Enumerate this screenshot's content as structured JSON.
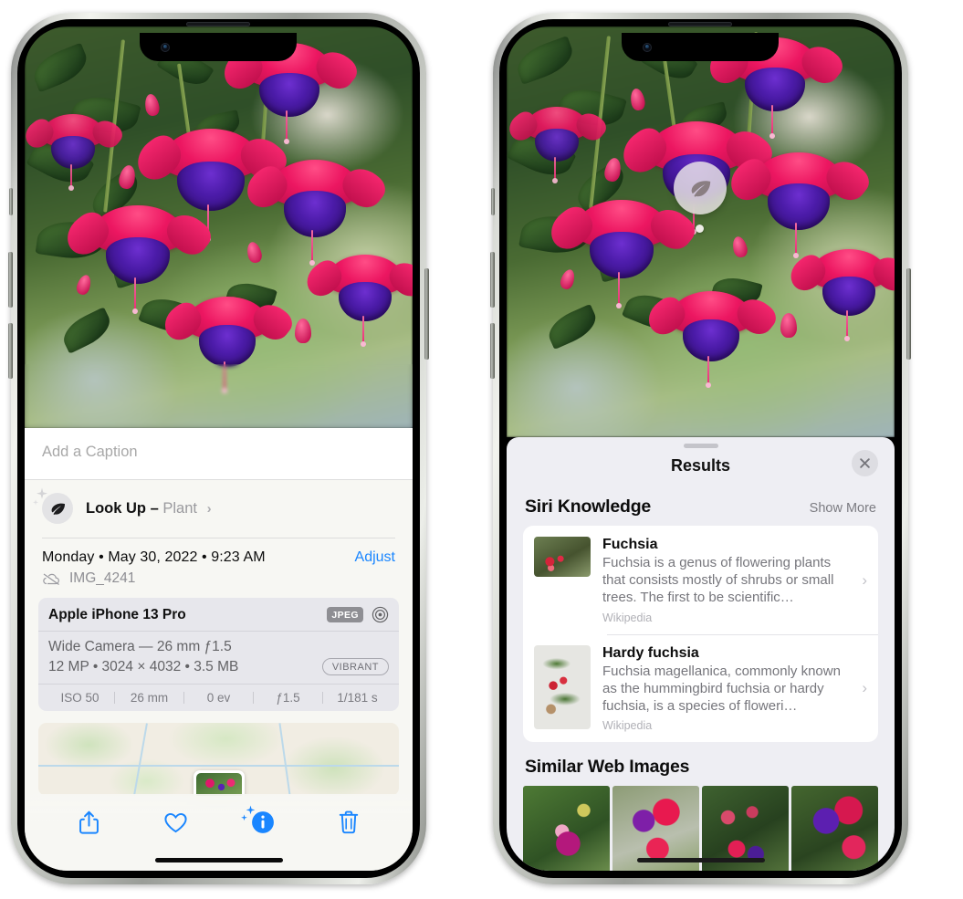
{
  "left_phone": {
    "photo": {
      "alt": "fuchsia-flowers-photo"
    },
    "caption_field": {
      "placeholder": "Add a Caption",
      "value": ""
    },
    "look_up": {
      "icon": "leaf-icon",
      "label": "Look Up –",
      "subject": "Plant",
      "chevron": "›"
    },
    "date_row": {
      "date_text": "Monday • May 30, 2022 • 9:23 AM",
      "adjust_label": "Adjust"
    },
    "file_row": {
      "icon": "cloud-slash-icon",
      "filename": "IMG_4241"
    },
    "camera_card": {
      "model": "Apple iPhone 13 Pro",
      "format_badge": "JPEG",
      "lens_icon": "aperture-icon",
      "lens_line": "Wide Camera — 26 mm ƒ1.5",
      "spec_line": "12 MP • 3024 × 4032 • 3.5 MB",
      "style_badge": "VIBRANT",
      "exif": [
        {
          "label": "ISO 50"
        },
        {
          "label": "26 mm"
        },
        {
          "label": "0 ev"
        },
        {
          "label": "ƒ1.5"
        },
        {
          "label": "1/181 s"
        }
      ]
    },
    "map": {
      "name": "photo-location-map",
      "pin": "photo-thumbnail-pin"
    },
    "toolbar": [
      {
        "name": "share-button",
        "icon": "share-icon",
        "active": false
      },
      {
        "name": "favorite-button",
        "icon": "heart-icon",
        "active": false
      },
      {
        "name": "info-button",
        "icon": "info-sparkle-icon",
        "active": true
      },
      {
        "name": "delete-button",
        "icon": "trash-icon",
        "active": false
      }
    ],
    "accent_color": "#1a86ff"
  },
  "right_phone": {
    "visual_look_up_badge": {
      "icon": "leaf-icon",
      "name": "visual-look-up-badge"
    },
    "sheet": {
      "grabber": "sheet-grabber",
      "title": "Results",
      "close_icon": "close-icon",
      "siri_knowledge": {
        "heading": "Siri Knowledge",
        "show_more": "Show More",
        "items": [
          {
            "title": "Fuchsia",
            "description": "Fuchsia is a genus of flowering plants that consists mostly of shrubs or small trees. The first to be scientific…",
            "source": "Wikipedia",
            "thumb": "fuchsia-thumbnail",
            "chevron": "›"
          },
          {
            "title": "Hardy fuchsia",
            "description": "Fuchsia magellanica, commonly known as the hummingbird fuchsia or hardy fuchsia, is a species of floweri…",
            "source": "Wikipedia",
            "thumb": "hardy-fuchsia-thumbnail",
            "chevron": "›"
          }
        ]
      },
      "similar_web_images": {
        "heading": "Similar Web Images",
        "thumbnails": [
          {
            "name": "web-image-1"
          },
          {
            "name": "web-image-2"
          },
          {
            "name": "web-image-3"
          },
          {
            "name": "web-image-4"
          }
        ]
      }
    }
  }
}
